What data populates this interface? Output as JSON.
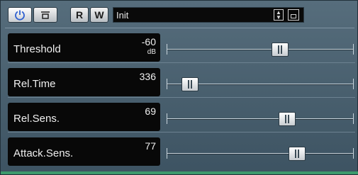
{
  "toolbar": {
    "power_icon": "power-icon",
    "bypass_icon": "bypass-icon",
    "read_label": "R",
    "write_label": "W",
    "preset_name": "Init",
    "preset_arrows_icon": "up-down-arrows-icon",
    "save_icon": "save-icon"
  },
  "parameters": [
    {
      "name": "Threshold",
      "value": "-60",
      "unit": "dB",
      "slider": 0.62
    },
    {
      "name": "Rel.Time",
      "value": "336",
      "unit": "",
      "slider": 0.08
    },
    {
      "name": "Rel.Sens.",
      "value": "69",
      "unit": "",
      "slider": 0.66
    },
    {
      "name": "Attack.Sens.",
      "value": "77",
      "unit": "",
      "slider": 0.72
    }
  ]
}
